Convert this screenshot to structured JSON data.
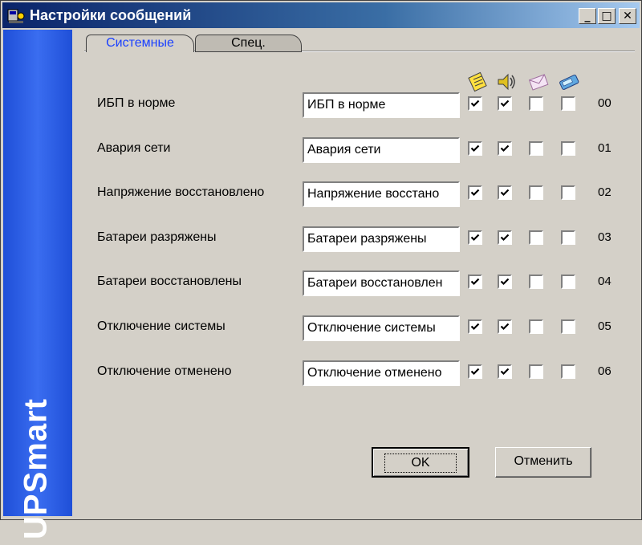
{
  "window": {
    "title": "Настройки сообщений"
  },
  "sidebar": {
    "brand": "UPSmart"
  },
  "titlebar_buttons": {
    "minimize": "_",
    "maximize": "□",
    "close": "✕"
  },
  "tabs": [
    {
      "label": "Системные",
      "active": true
    },
    {
      "label": "Спец.",
      "active": false
    }
  ],
  "header_icons": [
    "notepad-icon",
    "speaker-icon",
    "email-icon",
    "pager-icon"
  ],
  "rows": [
    {
      "label": "ИБП в норме",
      "value": "ИБП в норме",
      "checks": [
        true,
        true,
        false,
        false
      ],
      "code": "00"
    },
    {
      "label": "Авария сети",
      "value": "Авария сети",
      "checks": [
        true,
        true,
        false,
        false
      ],
      "code": "01"
    },
    {
      "label": "Напряжение восстановлено",
      "value": "Напряжение восстано",
      "checks": [
        true,
        true,
        false,
        false
      ],
      "code": "02"
    },
    {
      "label": "Батареи разряжены",
      "value": "Батареи разряжены",
      "checks": [
        true,
        true,
        false,
        false
      ],
      "code": "03"
    },
    {
      "label": "Батареи восстановлены",
      "value": "Батареи восстановлен",
      "checks": [
        true,
        true,
        false,
        false
      ],
      "code": "04"
    },
    {
      "label": "Отключение системы",
      "value": "Отключение системы",
      "checks": [
        true,
        true,
        false,
        false
      ],
      "code": "05"
    },
    {
      "label": "Отключение отменено",
      "value": "Отключение отменено",
      "checks": [
        true,
        true,
        false,
        false
      ],
      "code": "06"
    }
  ],
  "buttons": {
    "ok": "OK",
    "cancel": "Отменить"
  }
}
